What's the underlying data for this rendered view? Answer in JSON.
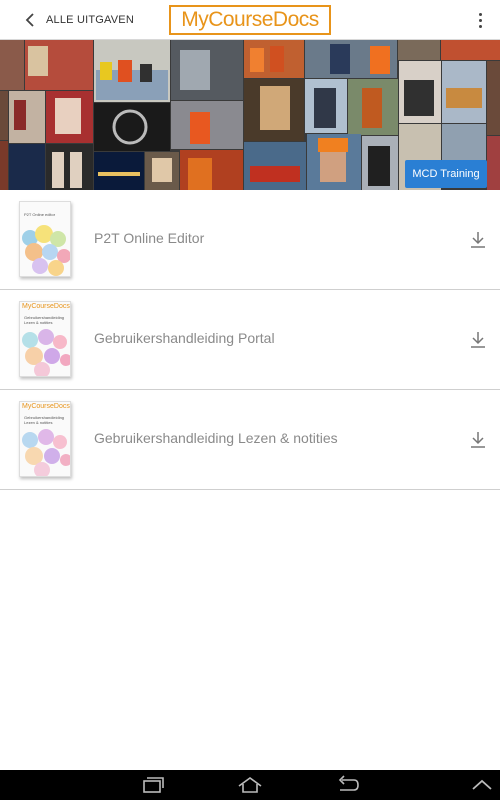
{
  "header": {
    "back_label": "ALLE UITGAVEN",
    "logo_text": "MyCourseDocs",
    "back_icon": "chevron-left-icon",
    "menu_icon": "overflow-menu-icon"
  },
  "banner": {
    "button_label": "MCD Training",
    "button_color": "#2a7fd4"
  },
  "documents": [
    {
      "title": "P2T Online Editor",
      "thumb_brand": "",
      "thumb_title": "P2T Online editor",
      "download_icon": "download-icon"
    },
    {
      "title": "Gebruikershandleiding Portal",
      "thumb_brand": "MyCourseDocs",
      "thumb_title": "Gebruikershandleiding Lezen & notities",
      "download_icon": "download-icon"
    },
    {
      "title": "Gebruikershandleiding Lezen & notities",
      "thumb_brand": "MyCourseDocs",
      "thumb_title": "Gebruikershandleiding Lezen & notities",
      "download_icon": "download-icon"
    }
  ],
  "navbar": {
    "icons": [
      "recent-apps-icon",
      "home-icon",
      "back-icon",
      "collapse-icon"
    ]
  },
  "colors": {
    "brand_orange": "#e8941a",
    "accent_blue": "#2a7fd4"
  }
}
